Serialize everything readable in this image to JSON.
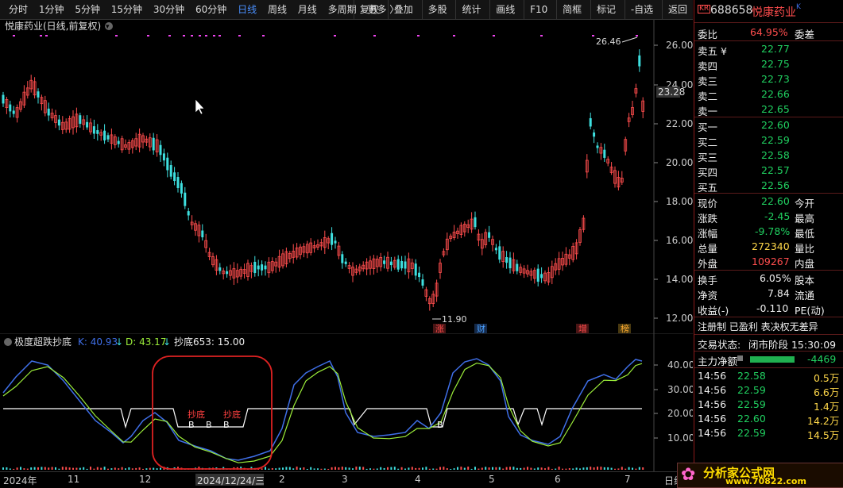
{
  "toolbar": {
    "tabs": [
      "分时",
      "1分钟",
      "5分钟",
      "15分钟",
      "30分钟",
      "60分钟",
      "日线",
      "周线",
      "月线",
      "多周期",
      "更多 〉"
    ],
    "active_tab": "日线",
    "tools": [
      "复权",
      "叠加",
      "多股",
      "统计",
      "画线",
      "F10",
      "简框",
      "标记",
      "-自选",
      "返回"
    ]
  },
  "main": {
    "title": "悦康药业(日线,前复权)",
    "price_labels": [
      "26.00",
      "24.00",
      "22.00",
      "20.00",
      "18.00",
      "16.00",
      "14.00",
      "12.00"
    ],
    "current_price": "23.28",
    "high_annotation": "26.46",
    "low_annotation": "11.90",
    "event_tags": [
      "涨",
      "财",
      "增",
      "榜"
    ]
  },
  "indicator": {
    "name": "极度超跌抄底",
    "k_label": "K: 40.93",
    "d_label": "D: 43.17",
    "c_label": "抄底653: 15.00",
    "axis_labels": [
      "40.00",
      "30.00",
      "20.00",
      "10.00"
    ],
    "signal_text": "抄底",
    "buy_mark": "B"
  },
  "dates": {
    "labels": [
      "2024年",
      "11",
      "12",
      "2024/12/24/三",
      "2",
      "3",
      "4",
      "5",
      "6",
      "7"
    ],
    "end_label": "日线"
  },
  "colors": {
    "up": "#ff4d4d",
    "down": "#3ee0e0",
    "k_line": "#3f6fe8",
    "d_line": "#9cee3a",
    "background": "#000000",
    "highlight": "#dd2222"
  },
  "quote": {
    "code_tag": "KR",
    "code": "688658",
    "name": "悦康药业",
    "webi_label": "委比",
    "webi_value": "64.95%",
    "weicha_label": "委差",
    "sell": [
      {
        "label": "卖五 ¥",
        "price": "22.77"
      },
      {
        "label": "卖四",
        "price": "22.75"
      },
      {
        "label": "卖三",
        "price": "22.73"
      },
      {
        "label": "卖二",
        "price": "22.66"
      },
      {
        "label": "卖一",
        "price": "22.65"
      }
    ],
    "buy": [
      {
        "label": "买一",
        "price": "22.60"
      },
      {
        "label": "买二",
        "price": "22.59"
      },
      {
        "label": "买三",
        "price": "22.58"
      },
      {
        "label": "买四",
        "price": "22.57"
      },
      {
        "label": "买五",
        "price": "22.56"
      }
    ],
    "stats": [
      {
        "label": "现价",
        "value": "22.60",
        "label2": "今开"
      },
      {
        "label": "涨跌",
        "value": "-2.45",
        "label2": "最高"
      },
      {
        "label": "涨幅",
        "value": "-9.78%",
        "label2": "最低"
      },
      {
        "label": "总量",
        "value": "272340",
        "label2": "量比"
      },
      {
        "label": "外盘",
        "value": "109267",
        "label2": "内盘"
      }
    ],
    "stats2": [
      {
        "label": "换手",
        "value": "6.05%",
        "label2": "股本"
      },
      {
        "label": "净资",
        "value": "7.84",
        "label2": "流通"
      },
      {
        "label": "收益(-)",
        "value": "-0.110",
        "label2": "PE(动)"
      }
    ],
    "tags": "注册制 已盈利 表决权无差异",
    "trade_status_label": "交易状态:",
    "trade_status": "闭市阶段 15:30:09",
    "main_flow_label": "主力净额",
    "main_flow_value": "-4469",
    "ticks": [
      {
        "time": "14:56",
        "price": "22.58",
        "vol": "0.5万"
      },
      {
        "time": "14:56",
        "price": "22.59",
        "vol": "6.6万"
      },
      {
        "time": "14:56",
        "price": "22.59",
        "vol": "1.4万"
      },
      {
        "time": "14:56",
        "price": "22.60",
        "vol": "14.2万"
      },
      {
        "time": "14:56",
        "price": "22.59",
        "vol": "14.5万"
      }
    ]
  },
  "watermark": {
    "text": "分析家公式网",
    "url": "www.70822.com"
  }
}
